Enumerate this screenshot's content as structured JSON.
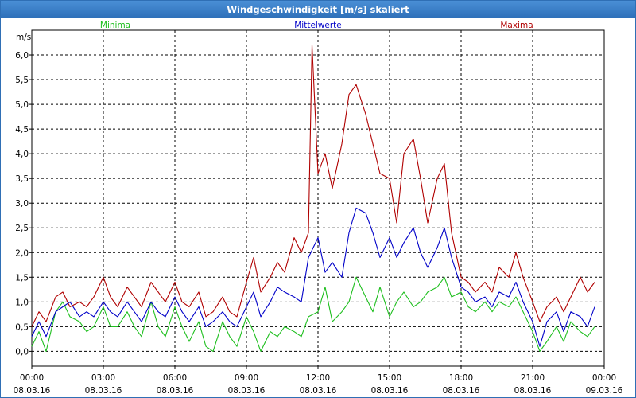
{
  "colors": {
    "min": "#1fbf1f",
    "mean": "#0000c8",
    "max": "#b00000"
  },
  "chart_data": {
    "type": "line",
    "title": "Windgeschwindigkeit [m/s] skaliert",
    "ylabel": "m/s",
    "ylim": [
      -0.3,
      6.5
    ],
    "xlim": [
      0,
      24
    ],
    "grid": true,
    "legend_placement": "top",
    "y_ticks": [
      "0,0",
      "0,5",
      "1,0",
      "1,5",
      "2,0",
      "2,5",
      "3,0",
      "3,5",
      "4,0",
      "4,5",
      "5,0",
      "5,5",
      "6,0"
    ],
    "x_ticks": [
      {
        "time": "00:00",
        "date": "08.03.16"
      },
      {
        "time": "03:00",
        "date": "08.03.16"
      },
      {
        "time": "06:00",
        "date": "08.03.16"
      },
      {
        "time": "09:00",
        "date": "08.03.16"
      },
      {
        "time": "12:00",
        "date": "08.03.16"
      },
      {
        "time": "15:00",
        "date": "08.03.16"
      },
      {
        "time": "18:00",
        "date": "08.03.16"
      },
      {
        "time": "21:00",
        "date": "08.03.16"
      },
      {
        "time": "00:00",
        "date": "09.03.16"
      }
    ],
    "series": [
      {
        "name": "Minima",
        "key": "min",
        "points": [
          [
            0,
            0.1
          ],
          [
            0.3,
            0.4
          ],
          [
            0.6,
            0.0
          ],
          [
            1.0,
            0.8
          ],
          [
            1.3,
            1.0
          ],
          [
            1.6,
            0.7
          ],
          [
            2.0,
            0.6
          ],
          [
            2.3,
            0.4
          ],
          [
            2.6,
            0.5
          ],
          [
            3.0,
            0.9
          ],
          [
            3.3,
            0.5
          ],
          [
            3.6,
            0.5
          ],
          [
            4.0,
            0.8
          ],
          [
            4.3,
            0.5
          ],
          [
            4.6,
            0.3
          ],
          [
            5.0,
            1.0
          ],
          [
            5.3,
            0.5
          ],
          [
            5.6,
            0.3
          ],
          [
            6.0,
            0.9
          ],
          [
            6.3,
            0.5
          ],
          [
            6.6,
            0.2
          ],
          [
            7.0,
            0.6
          ],
          [
            7.3,
            0.1
          ],
          [
            7.6,
            0.0
          ],
          [
            8.0,
            0.6
          ],
          [
            8.3,
            0.3
          ],
          [
            8.6,
            0.1
          ],
          [
            9.0,
            0.7
          ],
          [
            9.3,
            0.4
          ],
          [
            9.6,
            0.0
          ],
          [
            10.0,
            0.4
          ],
          [
            10.3,
            0.3
          ],
          [
            10.6,
            0.5
          ],
          [
            11.0,
            0.4
          ],
          [
            11.3,
            0.3
          ],
          [
            11.6,
            0.7
          ],
          [
            12.0,
            0.8
          ],
          [
            12.3,
            1.3
          ],
          [
            12.6,
            0.6
          ],
          [
            13.0,
            0.8
          ],
          [
            13.3,
            1.0
          ],
          [
            13.6,
            1.5
          ],
          [
            14.0,
            1.1
          ],
          [
            14.3,
            0.8
          ],
          [
            14.6,
            1.3
          ],
          [
            15.0,
            0.7
          ],
          [
            15.3,
            1.0
          ],
          [
            15.6,
            1.2
          ],
          [
            16.0,
            0.9
          ],
          [
            16.3,
            1.0
          ],
          [
            16.6,
            1.2
          ],
          [
            17.0,
            1.3
          ],
          [
            17.3,
            1.5
          ],
          [
            17.6,
            1.1
          ],
          [
            18.0,
            1.2
          ],
          [
            18.3,
            0.9
          ],
          [
            18.6,
            0.8
          ],
          [
            19.0,
            1.0
          ],
          [
            19.3,
            0.8
          ],
          [
            19.6,
            1.0
          ],
          [
            20.0,
            0.9
          ],
          [
            20.3,
            1.1
          ],
          [
            20.6,
            0.8
          ],
          [
            21.0,
            0.4
          ],
          [
            21.3,
            0.0
          ],
          [
            21.6,
            0.2
          ],
          [
            22.0,
            0.5
          ],
          [
            22.3,
            0.2
          ],
          [
            22.6,
            0.6
          ],
          [
            23.0,
            0.4
          ],
          [
            23.3,
            0.3
          ],
          [
            23.6,
            0.5
          ]
        ]
      },
      {
        "name": "Mittelwerte",
        "key": "mean",
        "points": [
          [
            0,
            0.3
          ],
          [
            0.3,
            0.6
          ],
          [
            0.6,
            0.3
          ],
          [
            1.0,
            0.8
          ],
          [
            1.3,
            0.9
          ],
          [
            1.6,
            1.0
          ],
          [
            2.0,
            0.7
          ],
          [
            2.3,
            0.8
          ],
          [
            2.6,
            0.7
          ],
          [
            3.0,
            1.0
          ],
          [
            3.3,
            0.8
          ],
          [
            3.6,
            0.7
          ],
          [
            4.0,
            1.0
          ],
          [
            4.3,
            0.8
          ],
          [
            4.6,
            0.6
          ],
          [
            5.0,
            1.0
          ],
          [
            5.3,
            0.8
          ],
          [
            5.6,
            0.7
          ],
          [
            6.0,
            1.1
          ],
          [
            6.3,
            0.8
          ],
          [
            6.6,
            0.6
          ],
          [
            7.0,
            0.9
          ],
          [
            7.3,
            0.5
          ],
          [
            7.6,
            0.6
          ],
          [
            8.0,
            0.8
          ],
          [
            8.3,
            0.6
          ],
          [
            8.6,
            0.5
          ],
          [
            9.0,
            0.9
          ],
          [
            9.3,
            1.2
          ],
          [
            9.6,
            0.7
          ],
          [
            10.0,
            1.0
          ],
          [
            10.3,
            1.3
          ],
          [
            10.6,
            1.2
          ],
          [
            11.0,
            1.1
          ],
          [
            11.3,
            1.0
          ],
          [
            11.6,
            1.9
          ],
          [
            12.0,
            2.3
          ],
          [
            12.3,
            1.6
          ],
          [
            12.6,
            1.8
          ],
          [
            13.0,
            1.5
          ],
          [
            13.3,
            2.4
          ],
          [
            13.6,
            2.9
          ],
          [
            14.0,
            2.8
          ],
          [
            14.3,
            2.4
          ],
          [
            14.6,
            1.9
          ],
          [
            15.0,
            2.3
          ],
          [
            15.3,
            1.9
          ],
          [
            15.6,
            2.2
          ],
          [
            16.0,
            2.5
          ],
          [
            16.3,
            2.0
          ],
          [
            16.6,
            1.7
          ],
          [
            17.0,
            2.1
          ],
          [
            17.3,
            2.5
          ],
          [
            17.6,
            1.9
          ],
          [
            18.0,
            1.3
          ],
          [
            18.3,
            1.2
          ],
          [
            18.6,
            1.0
          ],
          [
            19.0,
            1.1
          ],
          [
            19.3,
            0.9
          ],
          [
            19.6,
            1.2
          ],
          [
            20.0,
            1.1
          ],
          [
            20.3,
            1.4
          ],
          [
            20.6,
            1.0
          ],
          [
            21.0,
            0.6
          ],
          [
            21.3,
            0.1
          ],
          [
            21.6,
            0.6
          ],
          [
            22.0,
            0.8
          ],
          [
            22.3,
            0.4
          ],
          [
            22.6,
            0.8
          ],
          [
            23.0,
            0.7
          ],
          [
            23.3,
            0.5
          ],
          [
            23.6,
            0.9
          ]
        ]
      },
      {
        "name": "Maxima",
        "key": "max",
        "points": [
          [
            0,
            0.5
          ],
          [
            0.3,
            0.8
          ],
          [
            0.6,
            0.6
          ],
          [
            1.0,
            1.1
          ],
          [
            1.3,
            1.2
          ],
          [
            1.6,
            0.9
          ],
          [
            2.0,
            1.0
          ],
          [
            2.3,
            0.9
          ],
          [
            2.6,
            1.1
          ],
          [
            3.0,
            1.5
          ],
          [
            3.3,
            1.1
          ],
          [
            3.6,
            0.9
          ],
          [
            4.0,
            1.3
          ],
          [
            4.3,
            1.1
          ],
          [
            4.6,
            0.9
          ],
          [
            5.0,
            1.4
          ],
          [
            5.3,
            1.2
          ],
          [
            5.6,
            1.0
          ],
          [
            6.0,
            1.4
          ],
          [
            6.3,
            1.0
          ],
          [
            6.6,
            0.9
          ],
          [
            7.0,
            1.2
          ],
          [
            7.3,
            0.7
          ],
          [
            7.6,
            0.8
          ],
          [
            8.0,
            1.1
          ],
          [
            8.3,
            0.8
          ],
          [
            8.6,
            0.7
          ],
          [
            9.0,
            1.4
          ],
          [
            9.3,
            1.9
          ],
          [
            9.6,
            1.2
          ],
          [
            10.0,
            1.5
          ],
          [
            10.3,
            1.8
          ],
          [
            10.6,
            1.6
          ],
          [
            11.0,
            2.3
          ],
          [
            11.3,
            2.0
          ],
          [
            11.6,
            2.4
          ],
          [
            11.75,
            6.2
          ],
          [
            12.0,
            3.6
          ],
          [
            12.3,
            4.0
          ],
          [
            12.6,
            3.3
          ],
          [
            13.0,
            4.2
          ],
          [
            13.3,
            5.2
          ],
          [
            13.6,
            5.4
          ],
          [
            14.0,
            4.8
          ],
          [
            14.3,
            4.2
          ],
          [
            14.6,
            3.6
          ],
          [
            15.0,
            3.5
          ],
          [
            15.3,
            2.6
          ],
          [
            15.6,
            4.0
          ],
          [
            16.0,
            4.3
          ],
          [
            16.3,
            3.5
          ],
          [
            16.6,
            2.6
          ],
          [
            17.0,
            3.5
          ],
          [
            17.3,
            3.8
          ],
          [
            17.6,
            2.4
          ],
          [
            18.0,
            1.5
          ],
          [
            18.3,
            1.4
          ],
          [
            18.6,
            1.2
          ],
          [
            19.0,
            1.4
          ],
          [
            19.3,
            1.2
          ],
          [
            19.6,
            1.7
          ],
          [
            20.0,
            1.5
          ],
          [
            20.3,
            2.0
          ],
          [
            20.6,
            1.5
          ],
          [
            21.0,
            1.0
          ],
          [
            21.3,
            0.6
          ],
          [
            21.6,
            0.9
          ],
          [
            22.0,
            1.1
          ],
          [
            22.3,
            0.8
          ],
          [
            22.6,
            1.1
          ],
          [
            23.0,
            1.5
          ],
          [
            23.3,
            1.2
          ],
          [
            23.6,
            1.4
          ]
        ]
      }
    ]
  }
}
